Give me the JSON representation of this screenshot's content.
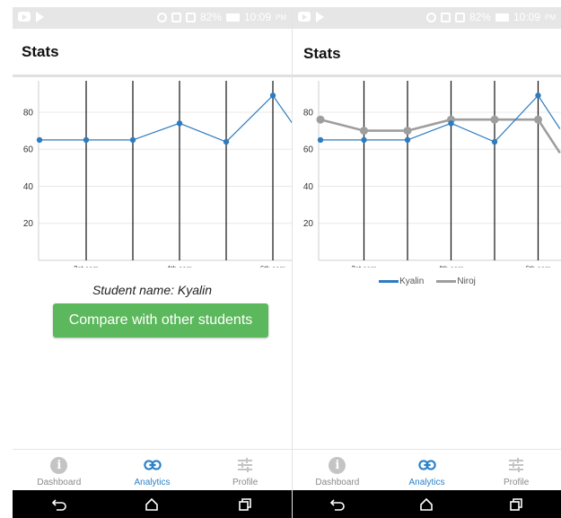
{
  "colors": {
    "kyalin_series": "#2e7bbf",
    "niroj_series": "#9e9e9e",
    "compare_button": "#5cb85c",
    "nav_active": "#2b82c9",
    "nav_inactive": "#8a8a8a"
  },
  "status_bar": {
    "battery": "82%",
    "time": "10:09",
    "ampm": "PM"
  },
  "left_screen": {
    "title": "Stats",
    "student_name": "Student name: Kyalin",
    "compare_button": "Compare with other students"
  },
  "right_screen": {
    "title": "Stats"
  },
  "bottom_nav": {
    "items": [
      {
        "label": "Dashboard",
        "icon": "info-icon",
        "active": false
      },
      {
        "label": "Analytics",
        "icon": "link-icon",
        "active": true
      },
      {
        "label": "Profile",
        "icon": "sliders-icon",
        "active": false
      }
    ]
  },
  "system_nav": {
    "icons": [
      "back-icon",
      "home-icon",
      "recents-icon"
    ]
  },
  "chart_data": [
    {
      "type": "line",
      "title": "",
      "xlabel": "",
      "ylabel": "",
      "x": [
        1,
        2,
        3,
        4,
        5,
        6
      ],
      "xtick_labels": [
        "2st sem",
        "4th sem",
        "6th sem"
      ],
      "xtick_positions": [
        2,
        4,
        6
      ],
      "yticks": [
        20,
        40,
        60,
        80
      ],
      "ylim": [
        0,
        95
      ],
      "grid": "vertical lines at each semester, horizontal gridlines",
      "series": [
        {
          "name": "Kyalin",
          "values": [
            65,
            65,
            65,
            74,
            64,
            89
          ]
        }
      ],
      "legend": "none"
    },
    {
      "type": "line",
      "title": "",
      "xlabel": "",
      "ylabel": "",
      "x": [
        1,
        2,
        3,
        4,
        5,
        6
      ],
      "xtick_labels": [
        "2st sem",
        "4th sem",
        "6th sem"
      ],
      "xtick_positions": [
        2,
        4,
        6
      ],
      "yticks": [
        20,
        40,
        60,
        80
      ],
      "ylim": [
        0,
        95
      ],
      "grid": "vertical lines at each semester, horizontal gridlines",
      "series": [
        {
          "name": "Kyalin",
          "values": [
            65,
            65,
            65,
            74,
            64,
            89
          ]
        },
        {
          "name": "Niroj",
          "values": [
            76,
            70,
            70,
            76,
            76,
            76
          ]
        }
      ],
      "legend": "bottom-center"
    }
  ]
}
